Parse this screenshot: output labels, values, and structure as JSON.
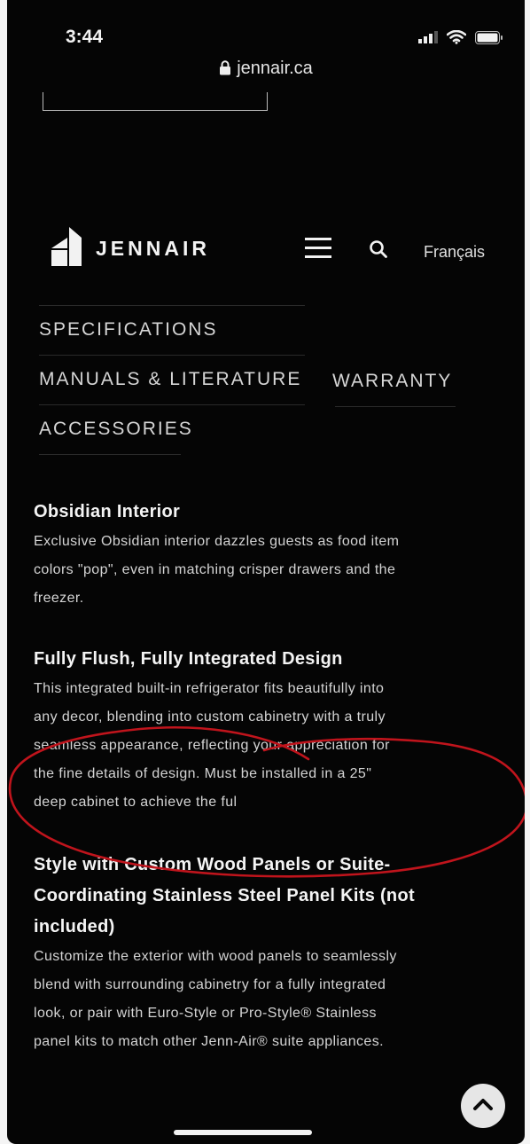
{
  "status_bar": {
    "time": "3:44"
  },
  "browser": {
    "url": "jennair.ca"
  },
  "header": {
    "brand": "JENNAIR",
    "language_link": "Français"
  },
  "nav": {
    "specifications": "SPECIFICATIONS",
    "manuals": "MANUALS & LITERATURE",
    "warranty": "WARRANTY",
    "accessories": "ACCESSORIES"
  },
  "sections": [
    {
      "title": "Obsidian Interior",
      "lines": [
        "Exclusive Obsidian interior dazzles guests as food item",
        "colors \"pop\", even in matching crisper drawers and the",
        "freezer."
      ]
    },
    {
      "title": "Fully Flush, Fully Integrated Design",
      "lines": [
        "This integrated built-in refrigerator fits beautifully into",
        "any decor, blending into custom cabinetry with a truly",
        "seamless appearance, reflecting your appreciation for",
        "the fine details of design. Must be installed in a 25\"",
        "deep cabinet to achieve the ful"
      ]
    },
    {
      "title_lines": [
        "Style with Custom Wood Panels or Suite-",
        "Coordinating Stainless Steel Panel Kits (not",
        "included)"
      ],
      "lines": [
        "Customize the exterior with wood panels to seamlessly",
        "blend with surrounding cabinetry for a fully integrated",
        "look, or pair with Euro-Style or Pro-Style® Stainless",
        "panel kits to match other Jenn-Air® suite appliances."
      ]
    }
  ],
  "icons": {
    "lock": "lock-icon",
    "menu": "hamburger-menu-icon",
    "search": "search-icon",
    "scroll_top": "chevron-up-icon",
    "signal": "signal-icon",
    "wifi": "wifi-icon",
    "battery": "battery-icon",
    "logo": "jennair-logo-icon"
  },
  "colors": {
    "background": "#050505",
    "text": "#e8e8e8",
    "annotation": "#c0141c"
  }
}
